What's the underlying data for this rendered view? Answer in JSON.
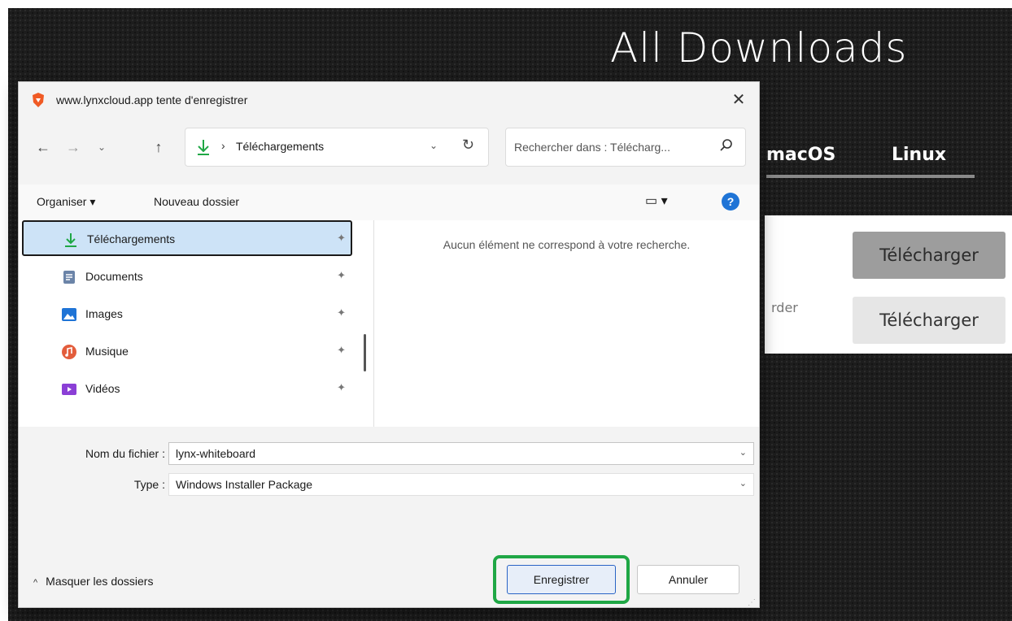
{
  "page": {
    "title": "All Downloads",
    "os_tabs": [
      "macOS",
      "Linux"
    ],
    "card_partial_text": "rder",
    "download_buttons": [
      "Télécharger",
      "Télécharger"
    ]
  },
  "dialog": {
    "title": "www.lynxcloud.app tente d'enregistrer",
    "close_glyph": "✕",
    "nav": {
      "back": "←",
      "forward": "→",
      "recent": "⌄",
      "up": "↑"
    },
    "address": {
      "separator": "›",
      "location": "Téléchargements",
      "dropdown": "⌄",
      "refresh": "↻"
    },
    "search_placeholder": "Rechercher dans : Télécharg...",
    "commands": {
      "organize": "Organiser ▾",
      "new_folder": "Nouveau dossier",
      "view": "▭ ▾",
      "help": "?"
    },
    "nav_items": [
      {
        "label": "Téléchargements",
        "icon": "download-icon",
        "color": "#1fa745"
      },
      {
        "label": "Documents",
        "icon": "document-icon",
        "color": "#6b84a8"
      },
      {
        "label": "Images",
        "icon": "image-icon",
        "color": "#1f74d6"
      },
      {
        "label": "Musique",
        "icon": "music-icon",
        "color": "#e35d3c"
      },
      {
        "label": "Vidéos",
        "icon": "video-icon",
        "color": "#8b3fd6"
      }
    ],
    "pin_glyph": "✦",
    "empty_message": "Aucun élément ne correspond à votre recherche.",
    "filename_label": "Nom du fichier :",
    "filename_value": "lynx-whiteboard",
    "type_label": "Type :",
    "type_value": "Windows Installer Package",
    "caret": "⌄",
    "hide_folders": "Masquer les dossiers",
    "hide_chevron": "^",
    "save_label": "Enregistrer",
    "cancel_label": "Annuler",
    "highlight_color": "#1fa745"
  }
}
